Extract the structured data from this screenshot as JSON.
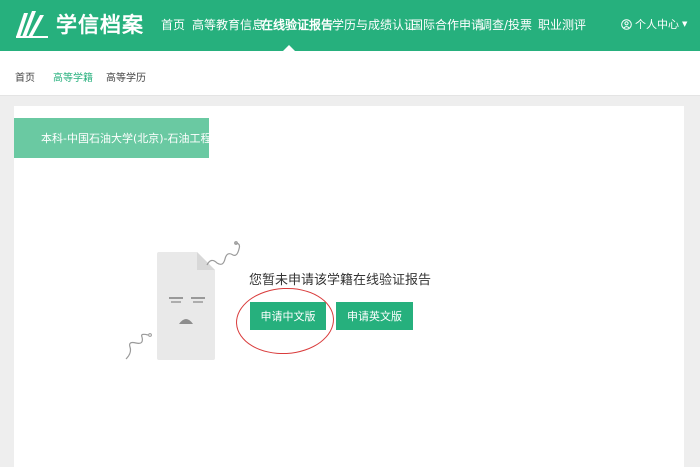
{
  "header": {
    "logo_text": "学信档案",
    "nav": [
      "首页",
      "高等教育信息",
      "在线验证报告",
      "学历与成绩认证",
      "国际合作申请",
      "调查/投票",
      "职业测评"
    ],
    "active_nav": "在线验证报告",
    "user_menu": "个人中心"
  },
  "subnav": {
    "items": [
      "首页",
      "高等学籍",
      "高等学历"
    ],
    "active": "高等学籍"
  },
  "record_tag": "本科-中国石油大学(北京)-石油工程",
  "empty_state": {
    "message": "您暂未申请该学籍在线验证报告",
    "apply_chinese": "申请中文版",
    "apply_english": "申请英文版"
  },
  "colors": {
    "brand": "#26b07d",
    "tag": "#6ac9a2",
    "annotation_circle": "#d93c3c"
  }
}
